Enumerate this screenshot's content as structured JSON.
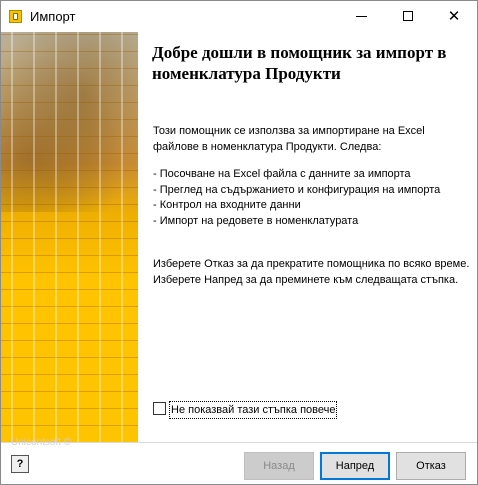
{
  "window": {
    "title": "Импорт",
    "minimize_icon": "minimize-icon",
    "maximize_icon": "maximize-icon",
    "close_icon": "close-icon",
    "close_glyph": "✕"
  },
  "sidebar": {
    "brand": "Unicontsoft ©"
  },
  "content": {
    "heading": "Добре дошли в помощник за импорт в номенклатура Продукти",
    "intro": "Този помощник се използва за импортиране на Excel файлове в номенклатура Продукти.  Следва:",
    "steps": "- Посочване на Excel файла с данните за импорта\n- Преглед на съдържанието и конфигурация на импорта\n- Контрол на входните данни\n- Импорт на редовете в номенклатурата",
    "cancel_info": "Изберете Отказ за да прекратите помощника по всяко време.  Изберете Напред за да преминете към следващата стъпка."
  },
  "checkbox": {
    "label": "Не показвай тази стъпка повече",
    "checked": false
  },
  "footer": {
    "help_label": "?",
    "back_label": "Назад",
    "next_label": "Напред",
    "cancel_label": "Отказ"
  },
  "colors": {
    "accent": "#0078d7",
    "sidebar_yellow": "#ffc400"
  }
}
